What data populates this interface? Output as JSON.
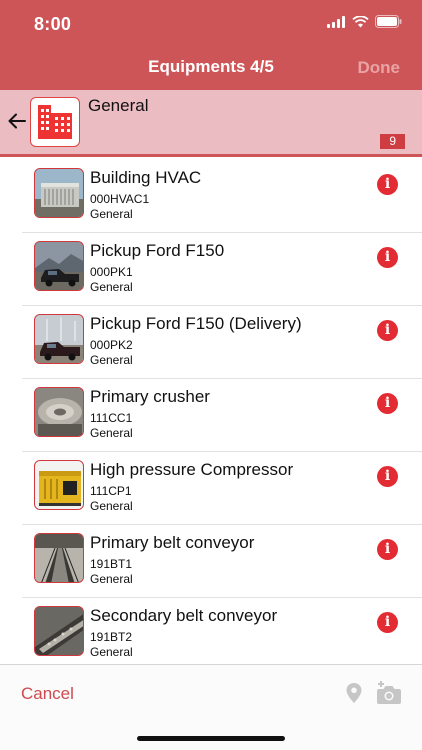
{
  "status_bar": {
    "time": "8:00"
  },
  "nav": {
    "title": "Equipments 4/5",
    "done_label": "Done"
  },
  "group": {
    "title": "General",
    "count": "9"
  },
  "equipments": [
    {
      "name": "Building HVAC",
      "code": "000HVAC1",
      "group": "General",
      "thumb": "hvac"
    },
    {
      "name": "Pickup Ford F150",
      "code": "000PK1",
      "group": "General",
      "thumb": "pickup"
    },
    {
      "name": "Pickup Ford F150 (Delivery)",
      "code": "000PK2",
      "group": "General",
      "thumb": "pickup-delivery"
    },
    {
      "name": "Primary crusher",
      "code": "111CC1",
      "group": "General",
      "thumb": "crusher"
    },
    {
      "name": "High pressure Compressor",
      "code": "111CP1",
      "group": "General",
      "thumb": "compressor"
    },
    {
      "name": "Primary belt conveyor",
      "code": "191BT1",
      "group": "General",
      "thumb": "conveyor"
    },
    {
      "name": "Secondary belt conveyor",
      "code": "191BT2",
      "group": "General",
      "thumb": "conveyor-2"
    }
  ],
  "footer": {
    "cancel_label": "Cancel"
  },
  "colors": {
    "accent": "#cd5558",
    "group_bg": "#ecbcc3",
    "info_red": "#e32b34"
  }
}
